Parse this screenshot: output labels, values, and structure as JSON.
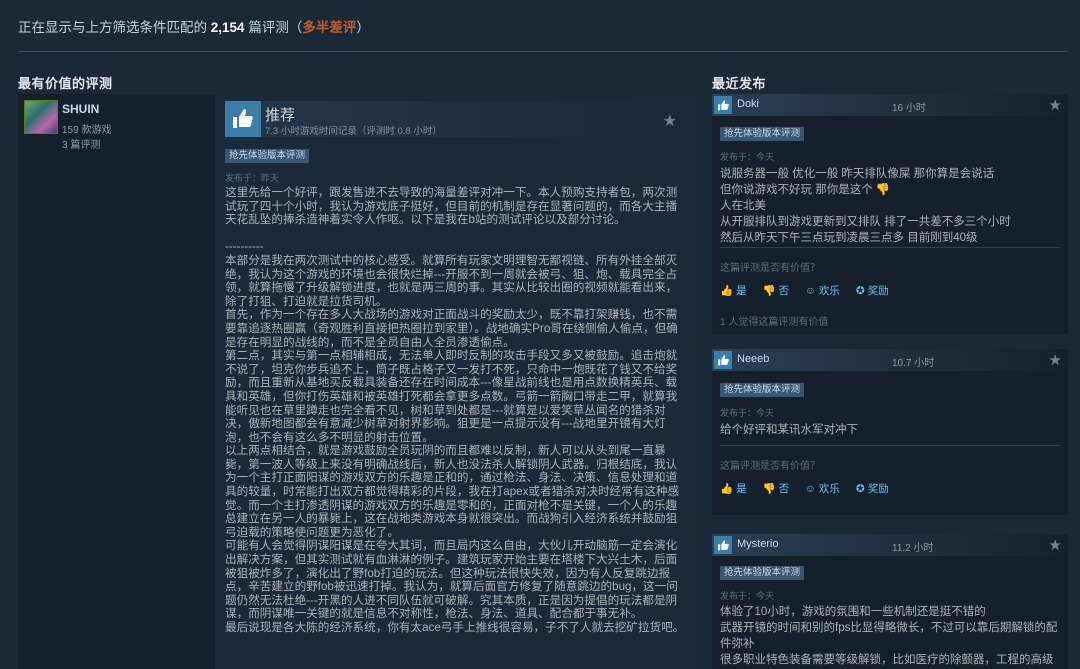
{
  "summary": {
    "prefix": "正在显示与上方筛选条件匹配的",
    "count": "2,154",
    "suffix": "篇评测（",
    "rating": "多半差评",
    "close": "）"
  },
  "sections": {
    "most_helpful": "最有价值的评测",
    "recent": "最近发布"
  },
  "main_review": {
    "username": "SHUIN",
    "games_owned": "159 款游戏",
    "reviews": "3 篇评测",
    "verdict": "推荐",
    "hours": "7.3 小时游戏时间记录（评测时 0.8 小时）",
    "early_access_tag": "抢先体验版本评测",
    "posted": "发布于：昨天",
    "body": "这里先给一个好评，跟发售进不去导致的海量差评对冲一下。本人预购支持者包，两次测试玩了四十个小时，我认为游戏底子挺好，但目前的机制是存在显著问题的，而各大主播天花乱坠的捧杀造神着实令人作呕。以下是我在b站的测试评论以及部分讨论。\n\n----------\n本部分是我在两次测试中的核心感受。就算所有玩家文明理智无鄙视链、所有外挂全部灭绝，我认为这个游戏的环境也会很快烂掉---开服不到一周就会被弓、狙、炮、载具完全占领，就算拖慢了升级解锁进度，也就是两三周的事。其实从比较出圈的视频就能看出来，除了打狙、打迫就是拉货司机。\n首先，作为一个存在多人大战场的游戏对正面战斗的奖励太少，既不靠打架赚钱，也不需要靠追逐热圈赢（奇观胜利直接把热圈拉到家里）。战地确实Pro哥在绕侧偷人偷点，但确是存在明显的战线的，而不是全员自由人全员渗透偷点。\n第二点，其实与第一点相辅相成，无法单人即时反制的攻击手段又多又被鼓励。追击炮就不说了，坦克你步兵追不上，筒子既占格子又一发打不死，只命中一炮既花了钱又不给奖励，而且重新从基地买反载具装备还存在时间成本---像星战前线也是用点数换精英兵、载具和英雄，但你打伤英雄和被英雄打死都会拿更多点数。弓箭一箭胸口带走二甲，就算我能听见也在草里蹲走也完全看不见，树和草到处都是---就算是以爱笑草丛闻名的猎杀对决，傲新地图都会有意减少树草对射界影响。狙更是一点提示没有---战地里开镜有大灯泡，也不会有这么多不明显的射击位置。\n以上两点相结合，就是游戏鼓励全员玩阴的而且都难以反制，新人可以从头到尾一直暴毙，第一波人等级上来没有明确战线后，新人也没法杀人解锁阴人武器。归根结底，我认为一个主打正面阳谋的游戏双方的乐趣是正和的，通过枪法、身法、决策、信息处理和道具的较量，时常能打出双方都觉得精彩的片段，我在打apex或者猎杀对决时经常有这种感觉。而一个主打渗透阴谋的游戏双方的乐趣是零和的，正面对枪不是关键，一个人的乐趣总建立在另一人的暴毙上，这在战地类游戏本身就很突出。而战狗引入经济系统并鼓励狙弓迫载的策略使问题更为恶化了。\n可能有人会觉得阴谋阳谋是在夸大其词，而且局内这么自由，大伙儿开动脑筋一定会演化出解决方案，但其实测试就有血淋淋的例子。建筑玩家开始主要在塔楼下大兴土木，后面被狙被炸多了，演化出了野fob打迫的玩法。但这种玩法很快失效，因为有人反复跳边报点，辛苦建立的野fob被迅速打掉。我认为，就算后面官方修复了随意跳边的bug，这一问题仍然无法杜绝---开黑的人进不同队伍就可破解。究其本质，正是因为提倡的玩法都是阴谋，而阴谋唯一关键的就是信息不对称性，枪法、身法、道具、配合都于事无补。\n最后说现是各大陈的经济系统，你有太ace弓手上推线很容易，子不了人就去挖矿拉货吧。"
  },
  "recent_reviews": [
    {
      "name": "Doki",
      "time": "16 小时",
      "tag": "抢先体验版本评测",
      "posted": "发布于：今天",
      "body": "说服务器一般 优化一般 昨天排队像屎 那你算是会说话\n但你说游戏不好玩 那你是这个 👎\n人在北美\n从开服排队到游戏更新到又排队 排了一共差不多三个小时\n然后从昨天下午三点玩到凌晨三点多 目前刚到40级",
      "helpful_q": "这篇评测是否有价值？",
      "yes": "是",
      "no": "否",
      "funny": "欢乐",
      "award": "奖励",
      "found": "1 人觉得这篇评测有价值"
    },
    {
      "name": "Neeeb",
      "time": "10.7 小时",
      "tag": "抢先体验版本评测",
      "posted": "发布于：今天",
      "body": "给个好评和某讯水军对冲下",
      "helpful_q": "这篇评测是否有价值？",
      "yes": "是",
      "no": "否",
      "funny": "欢乐",
      "award": "奖励"
    },
    {
      "name": "Mysterio",
      "time": "11.2 小时",
      "tag": "抢先体验版本评测",
      "posted": "发布于：今天",
      "body": "体验了10小时，游戏的氛围和一些机制还是挺不错的\n武器开镜的时间和别的fps比显得略微长，不过可以靠后期解锁的配件弥补\n很多职业特色装备需要等级解锁，比如医疗的除颤器，工程的高级"
    }
  ],
  "colors": {
    "background": "#1b2838",
    "rating_mostly_negative": "#c35c2c",
    "link_blue": "#66c0f4",
    "thumb_blue": "#3c7ea8"
  }
}
